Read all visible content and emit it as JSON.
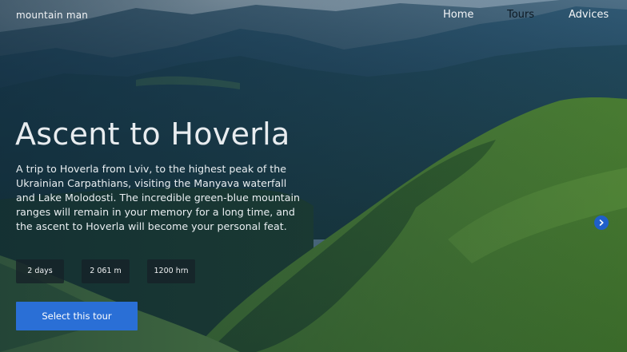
{
  "brand": {
    "logo_text": "mountain man"
  },
  "nav": {
    "items": [
      {
        "label": "Home",
        "active": false
      },
      {
        "label": "Tours",
        "active": true
      },
      {
        "label": "Advices",
        "active": false
      }
    ]
  },
  "hero": {
    "title": "Ascent to Hoverla",
    "description": "A trip to Hoverla from Lviv, to the highest peak of the Ukrainian Carpathians, visiting the Manyava waterfall and Lake Molodosti. The incredible green-blue mountain ranges will remain in your memory for a long time, and the ascent to Hoverla will become your personal feat.",
    "stats": {
      "duration": "2 days",
      "altitude": "2 061 m",
      "price": "1200 hrn"
    },
    "cta_label": "Select this tour"
  },
  "colors": {
    "accent": "#2a6fd6",
    "active_nav": "#0d1a24",
    "stat_background": "#162128"
  },
  "icons": {
    "carousel_next": "chevron-right-icon"
  }
}
